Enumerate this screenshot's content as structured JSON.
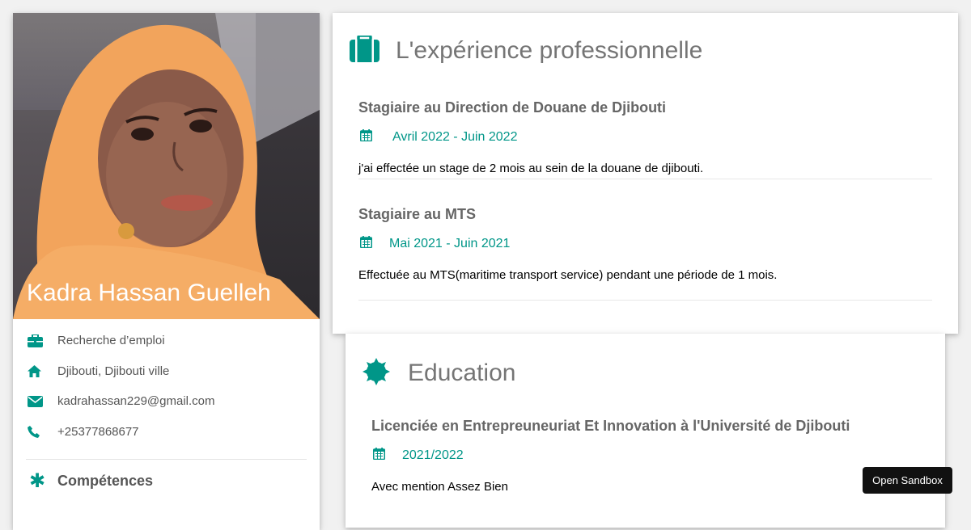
{
  "profile": {
    "name": "Kadra Hassan Guelleh",
    "info": [
      {
        "icon": "briefcase-icon",
        "text": "Recherche d’emploi"
      },
      {
        "icon": "home-icon",
        "text": "Djibouti, Djibouti ville"
      },
      {
        "icon": "envelope-icon",
        "text": "kadrahassan229@gmail.com"
      },
      {
        "icon": "phone-icon",
        "text": "+25377868677"
      }
    ],
    "skills_title": "Compétences"
  },
  "experience": {
    "title": "L'expérience professionnelle",
    "jobs": [
      {
        "title": "Stagiaire au Direction de Douane de Djibouti",
        "dates": "Avril 2022 - Juin 2022",
        "description": "j'ai effectée un stage de 2 mois au sein de la douane de djibouti."
      },
      {
        "title": "Stagiaire au MTS",
        "dates": "Mai 2021 - Juin 2021",
        "description": "Effectuée au MTS(maritime transport service) pendant une période de 1 mois."
      }
    ]
  },
  "education": {
    "title": "Education",
    "items": [
      {
        "title": "Licenciée en Entrepreuneuriat Et Innovation à l'Université de Djibouti",
        "dates": "2021/2022",
        "description": "Avec mention Assez Bien"
      }
    ]
  },
  "sandbox_button": "Open Sandbox",
  "colors": {
    "accent": "#009688",
    "background": "#f1f1f1",
    "heading": "#757575",
    "subheading": "#666666"
  }
}
